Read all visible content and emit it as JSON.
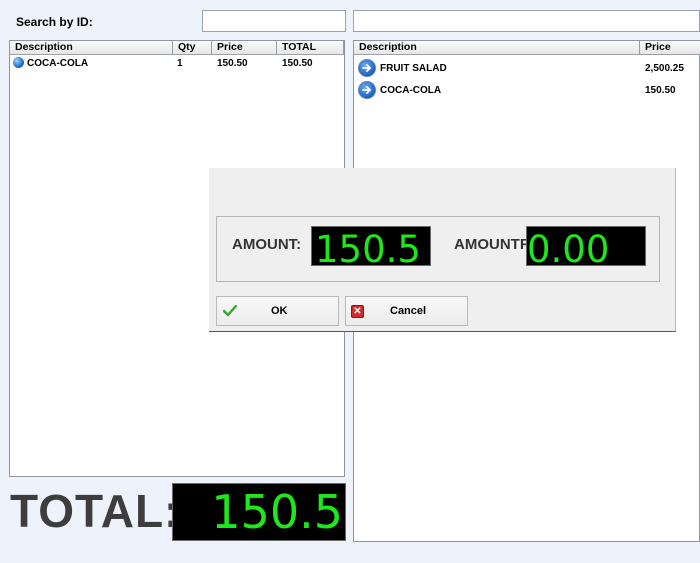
{
  "search": {
    "label": "Search by ID:",
    "value": "",
    "value2": ""
  },
  "cart": {
    "columns": [
      "Description",
      "Qty",
      "Price",
      "TOTAL"
    ],
    "rows": [
      {
        "description": "COCA-COLA",
        "qty": "1",
        "price": "150.50",
        "total": "150.50",
        "icon": "blue-dot-icon"
      }
    ]
  },
  "products": {
    "columns": [
      "Description",
      "Price"
    ],
    "rows": [
      {
        "description": "FRUIT SALAD",
        "price": "2,500.25",
        "icon": "arrow-right-icon"
      },
      {
        "description": "COCA-COLA",
        "price": "150.50",
        "icon": "arrow-right-icon"
      }
    ]
  },
  "total": {
    "label": "TOTAL:",
    "value": "150.5"
  },
  "payment_dialog": {
    "amount_label": "AMOUNT:",
    "amount_value": "150.5",
    "amount2_label": "AMOUNTR",
    "amount2_value": "0.00",
    "ok_label": "OK",
    "cancel_label": "Cancel"
  },
  "colors": {
    "lcd_text": "#1ee81a",
    "lcd_bg": "#000000",
    "ok_icon": "#2ea82e",
    "cancel_icon": "#d42a2a"
  }
}
